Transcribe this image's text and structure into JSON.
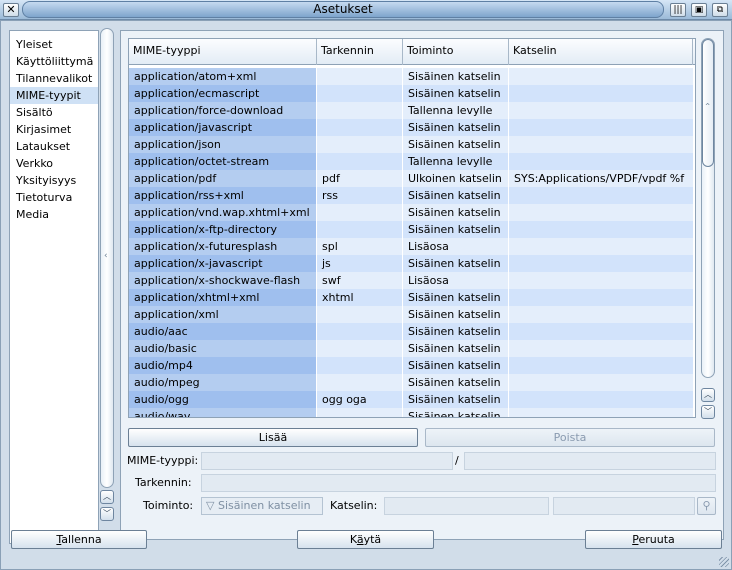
{
  "window": {
    "title": "Asetukset",
    "close_glyph": "✕",
    "buttons": [
      "|||",
      "▣",
      "⧉"
    ]
  },
  "categories": [
    {
      "label": "Yleiset",
      "selected": false
    },
    {
      "label": "Käyttöliittymä",
      "selected": false
    },
    {
      "label": "Tilannevalikot",
      "selected": false
    },
    {
      "label": "MIME-tyypit",
      "selected": true
    },
    {
      "label": "Sisältö",
      "selected": false
    },
    {
      "label": "Kirjasimet",
      "selected": false
    },
    {
      "label": "Lataukset",
      "selected": false
    },
    {
      "label": "Verkko",
      "selected": false
    },
    {
      "label": "Yksityisyys",
      "selected": false
    },
    {
      "label": "Tietoturva",
      "selected": false
    },
    {
      "label": "Media",
      "selected": false
    }
  ],
  "table": {
    "columns": [
      "MIME-tyyppi",
      "Tarkennin",
      "Toiminto",
      "Katselin"
    ],
    "rows": [
      [
        "application/atom+xml",
        "",
        "Sisäinen katselin",
        ""
      ],
      [
        "application/ecmascript",
        "",
        "Sisäinen katselin",
        ""
      ],
      [
        "application/force-download",
        "",
        "Tallenna levylle",
        ""
      ],
      [
        "application/javascript",
        "",
        "Sisäinen katselin",
        ""
      ],
      [
        "application/json",
        "",
        "Sisäinen katselin",
        ""
      ],
      [
        "application/octet-stream",
        "",
        "Tallenna levylle",
        ""
      ],
      [
        "application/pdf",
        "pdf",
        "Ulkoinen katselin",
        "SYS:Applications/VPDF/vpdf %f"
      ],
      [
        "application/rss+xml",
        "rss",
        "Sisäinen katselin",
        ""
      ],
      [
        "application/vnd.wap.xhtml+xml",
        "",
        "Sisäinen katselin",
        ""
      ],
      [
        "application/x-ftp-directory",
        "",
        "Sisäinen katselin",
        ""
      ],
      [
        "application/x-futuresplash",
        "spl",
        "Lisäosa",
        ""
      ],
      [
        "application/x-javascript",
        "js",
        "Sisäinen katselin",
        ""
      ],
      [
        "application/x-shockwave-flash",
        "swf",
        "Lisäosa",
        ""
      ],
      [
        "application/xhtml+xml",
        "xhtml",
        "Sisäinen katselin",
        ""
      ],
      [
        "application/xml",
        "",
        "Sisäinen katselin",
        ""
      ],
      [
        "audio/aac",
        "",
        "Sisäinen katselin",
        ""
      ],
      [
        "audio/basic",
        "",
        "Sisäinen katselin",
        ""
      ],
      [
        "audio/mp4",
        "",
        "Sisäinen katselin",
        ""
      ],
      [
        "audio/mpeg",
        "",
        "Sisäinen katselin",
        ""
      ],
      [
        "audio/ogg",
        "ogg oga",
        "Sisäinen katselin",
        ""
      ],
      [
        "audio/wav",
        "",
        "Sisäinen katselin",
        ""
      ]
    ]
  },
  "buttons": {
    "add": "Lisää",
    "remove": "Poista"
  },
  "form": {
    "mime_label": "MIME-tyyppi:",
    "mime_separator": "/",
    "extension_label": "Tarkennin:",
    "action_label": "Toiminto:",
    "action_value": "Sisäinen katselin",
    "action_arrow": "▽",
    "viewer_label": "Katselin:",
    "search_glyph": "⚲"
  },
  "bottom": {
    "save_ul": "T",
    "save_rest": "allenna",
    "use_pre": "K",
    "use_ul": "ä",
    "use_rest": "ytä",
    "cancel_ul": "P",
    "cancel_rest": "eruuta"
  },
  "scroll_glyphs": {
    "up": "︿",
    "down": "﹀",
    "grip": "‹"
  }
}
